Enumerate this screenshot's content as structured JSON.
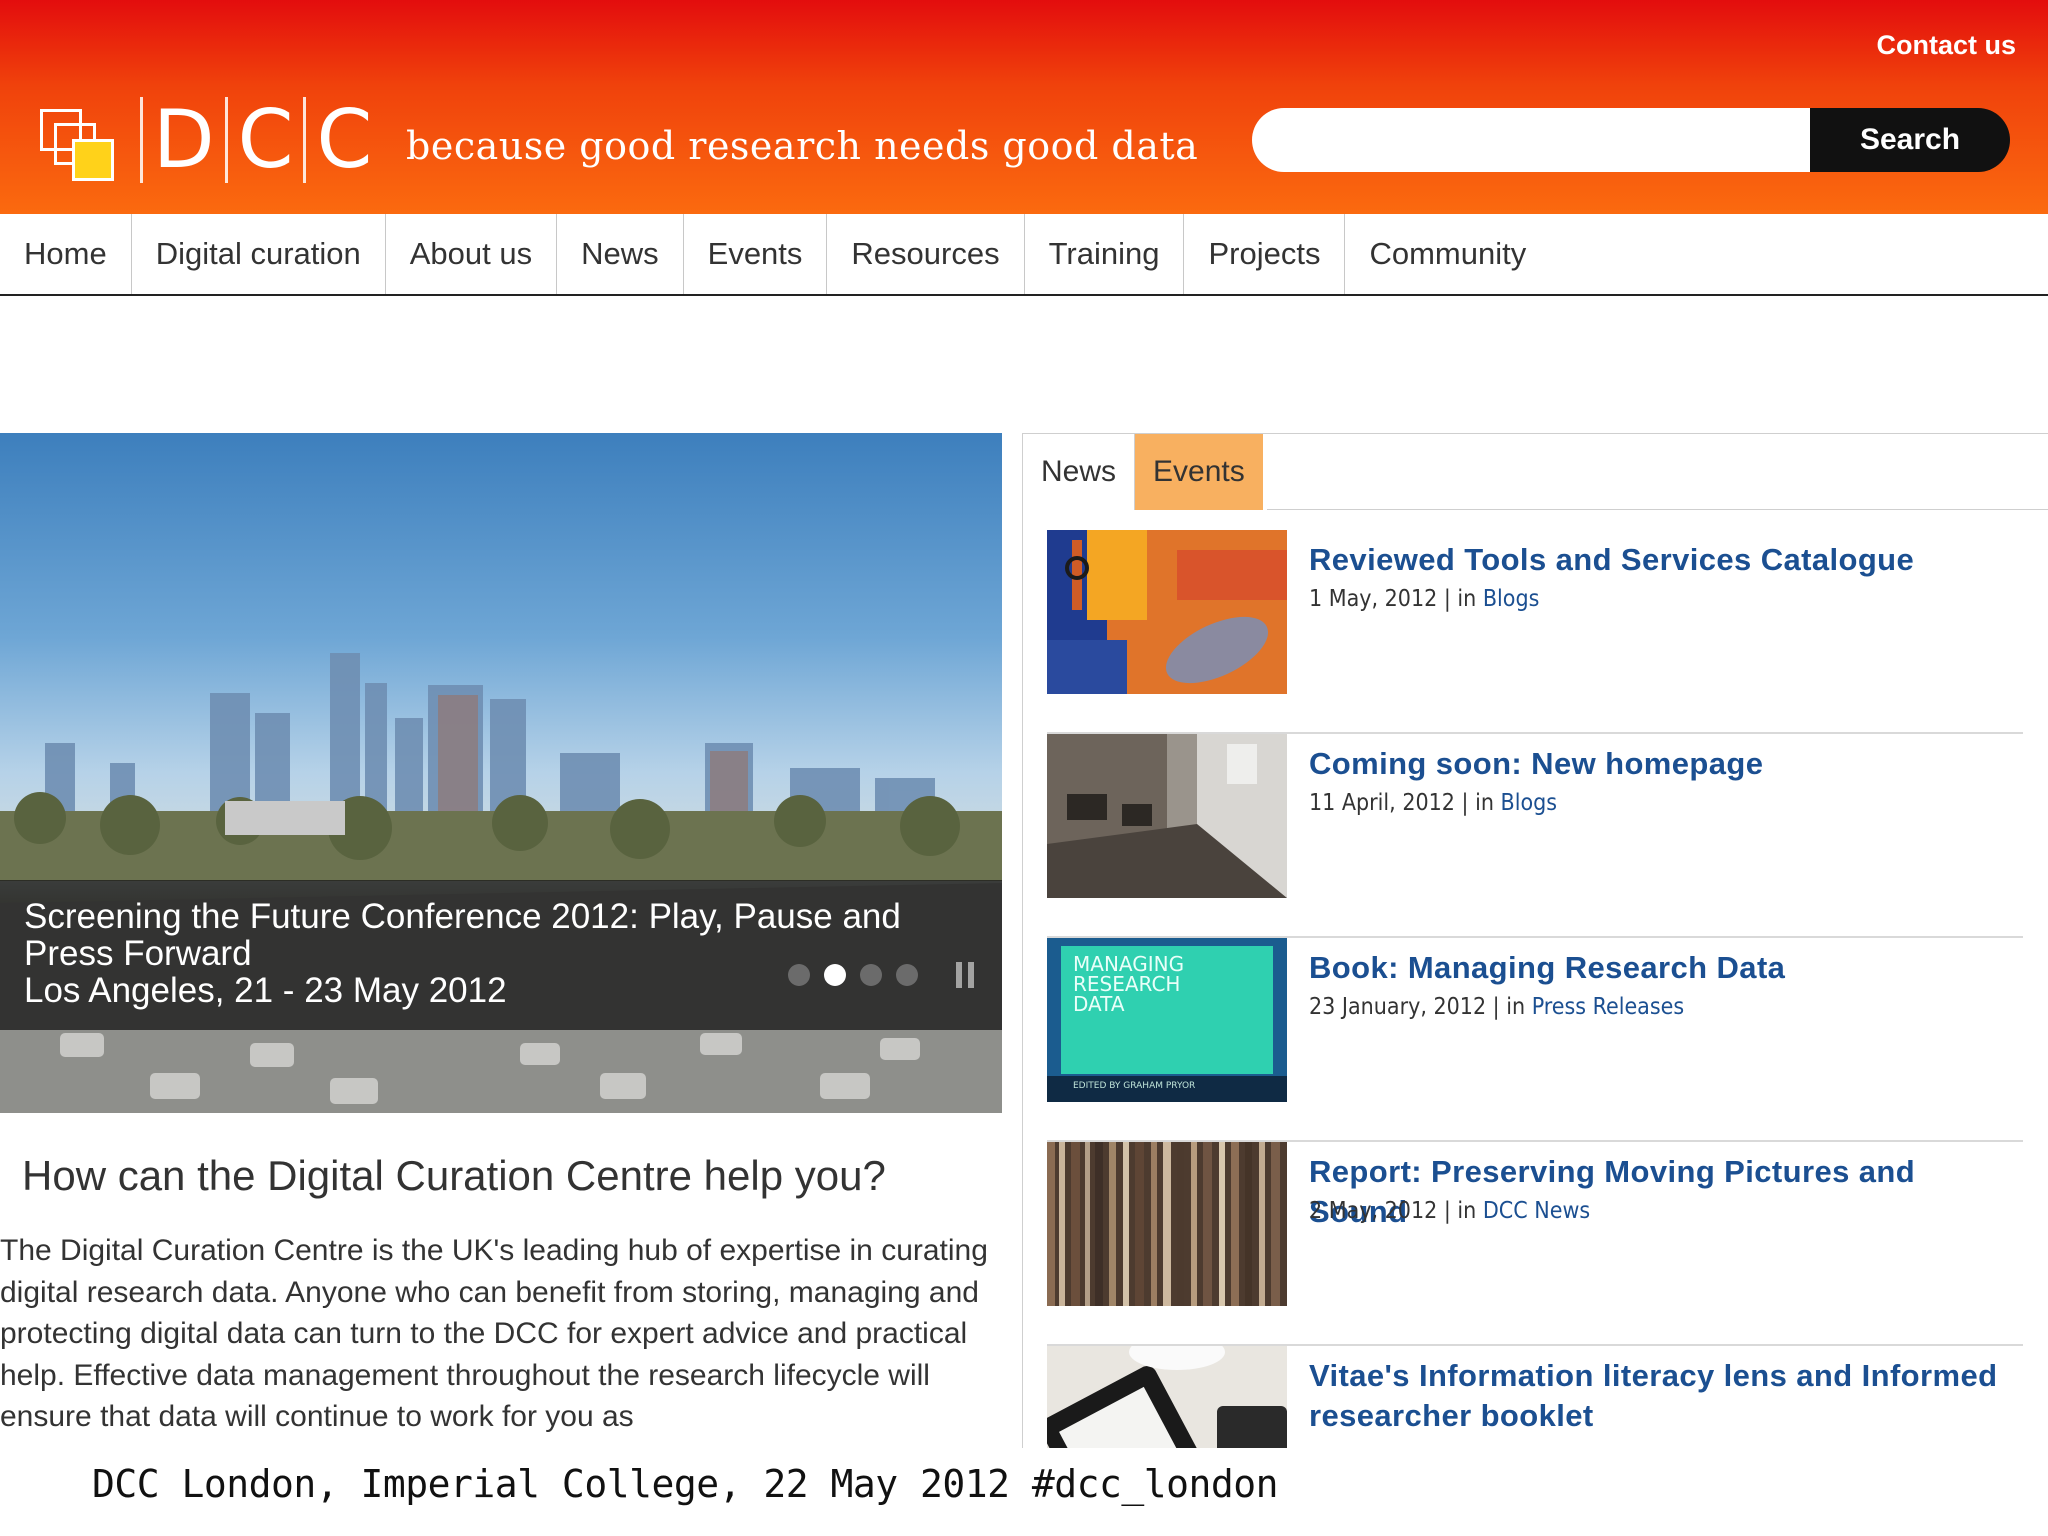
{
  "header": {
    "contact_label": "Contact us",
    "logo_text": [
      "D",
      "C",
      "C"
    ],
    "tagline": "because good research needs good data",
    "search_placeholder": "",
    "search_label": "Search"
  },
  "nav": {
    "items": [
      "Home",
      "Digital curation",
      "About us",
      "News",
      "Events",
      "Resources",
      "Training",
      "Projects",
      "Community"
    ]
  },
  "hero": {
    "caption_line1": "Screening the Future Conference 2012: Play, Pause and Press Forward",
    "caption_line2": "Los Angeles, 21 - 23 May 2012",
    "slide_count": 4,
    "active_slide": 2
  },
  "intro": {
    "heading": "How can the Digital Curation Centre help you?",
    "body": "The Digital Curation Centre is the UK's leading hub of expertise in curating digital research data. Anyone who can benefit from storing, managing and protecting digital data can turn to the DCC for expert advice and practical help. Effective data management throughout the research lifecycle will ensure that data will continue to work for you as"
  },
  "panel": {
    "tabs": [
      "News",
      "Events"
    ],
    "items": [
      {
        "title": "Reviewed Tools and Services Catalogue",
        "date": "1 May, 2012 | in",
        "category": "Blogs",
        "thumb": "tools-wrench-image"
      },
      {
        "title": "Coming soon: New homepage",
        "date": "11 April, 2012 | in",
        "category": "Blogs",
        "thumb": "construction-room-image"
      },
      {
        "title": "Book: Managing Research Data",
        "date": "23 January, 2012 | in",
        "category": "Press Releases",
        "thumb": "book-cover-image",
        "thumb_text": "MANAGING RESEARCH DATA",
        "thumb_sub": "EDITED BY GRAHAM PRYOR"
      },
      {
        "title": "Report: Preserving Moving Pictures and Sound",
        "date": "2 May, 2012 | in",
        "category": "DCC News",
        "thumb": "film-reels-image"
      },
      {
        "title": "Vitae's Information literacy lens and Informed researcher booklet",
        "date": "",
        "category": "",
        "thumb": "tablet-desk-image"
      }
    ]
  },
  "footer": {
    "caption": "DCC London, Imperial College, 22 May 2012 #dcc_london"
  },
  "colors": {
    "header_top": "#e30d0d",
    "header_bottom": "#fb6a0f",
    "link_blue": "#1b4f91",
    "events_tab": "#f8b060"
  }
}
